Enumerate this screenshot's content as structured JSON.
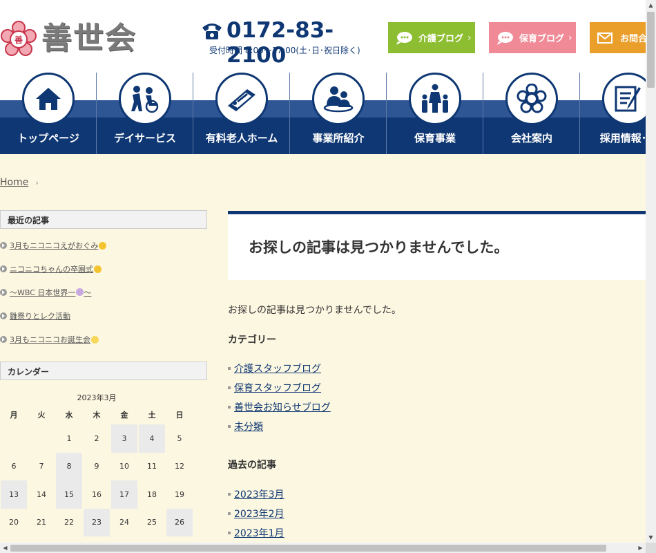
{
  "header": {
    "logo_text": "善世会",
    "phone_number": "0172-83-2100",
    "phone_hours": "受付時間 8:00〜17:00(土･日･祝日除く)",
    "buttons": [
      {
        "label": "介護ブログ",
        "icon": "speech-bubble-icon",
        "color": "#8dbd30"
      },
      {
        "label": "保育ブログ",
        "icon": "speech-bubble-icon",
        "color": "#ef8a96"
      },
      {
        "label": "お問合せ",
        "icon": "mail-icon",
        "color": "#eb9f2b"
      }
    ]
  },
  "nav": {
    "items": [
      {
        "label": "トップページ",
        "icon": "home-icon"
      },
      {
        "label": "デイサービス",
        "icon": "caregiver-wheelchair-icon"
      },
      {
        "label": "有料老人ホーム",
        "icon": "bed-icon"
      },
      {
        "label": "事業所紹介",
        "icon": "people-icon"
      },
      {
        "label": "保育事業",
        "icon": "family-icon"
      },
      {
        "label": "会社案内",
        "icon": "emblem-icon"
      },
      {
        "label": "採用情報･求",
        "icon": "document-pen-icon"
      }
    ]
  },
  "breadcrumb": {
    "home": "Home",
    "sep": "›"
  },
  "sidebar": {
    "recent_title": "最近の記事",
    "recent": [
      {
        "text": "3月もニコニコえがおぐみ",
        "emoji": true
      },
      {
        "text": "ニコニコちゃんの卒園式",
        "emoji": true
      },
      {
        "text": "〜WBC 日本世界一",
        "suffix": "〜",
        "emoji": true
      },
      {
        "text": "雛祭りとレク活動",
        "emoji": false
      },
      {
        "text": "3月もニコニコお誕生会",
        "emoji": true
      }
    ],
    "calendar_title": "カレンダー",
    "calendar": {
      "caption": "2023年3月",
      "weekdays": [
        "月",
        "火",
        "水",
        "木",
        "金",
        "土",
        "日"
      ],
      "days": [
        "",
        "",
        "1",
        "2",
        "3",
        "4",
        "5",
        "6",
        "7",
        "8",
        "9",
        "10",
        "11",
        "12",
        "13",
        "14",
        "15",
        "16",
        "17",
        "18",
        "19",
        "20",
        "21",
        "22",
        "23",
        "24",
        "25",
        "26"
      ],
      "linked_days": [
        "3",
        "4",
        "8",
        "13",
        "15",
        "17",
        "23",
        "26"
      ]
    }
  },
  "main": {
    "title": "お探しの記事は見つかりませんでした。",
    "message": "お探しの記事は見つかりませんでした。",
    "categories_heading": "カテゴリー",
    "categories": [
      "介護スタッフブログ",
      "保育スタッフブログ",
      "善世会お知らせブログ",
      "未分類"
    ],
    "archives_heading": "過去の記事",
    "archives": [
      "2023年3月",
      "2023年2月",
      "2023年1月"
    ]
  },
  "colors": {
    "navy": "#0e3773",
    "cream": "#fcf7e1",
    "green": "#8dbd30",
    "pink": "#ef8a96",
    "orange": "#eb9f2b"
  }
}
